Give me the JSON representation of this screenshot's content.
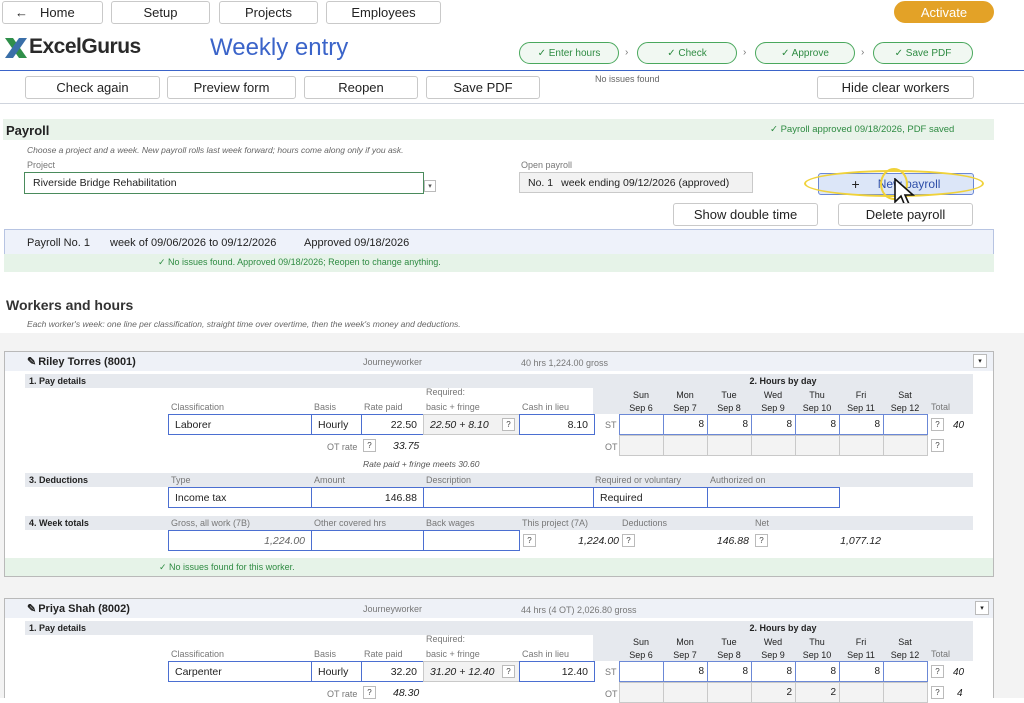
{
  "nav": {
    "home": "Home",
    "setup": "Setup",
    "projects": "Projects",
    "employees": "Employees",
    "activate": "Activate",
    "back_glyph": "←"
  },
  "brand": {
    "logo_text": "ExcelGurus",
    "page_title": "Weekly entry"
  },
  "steps": [
    "✓ Enter hours",
    "✓ Check",
    "✓ Approve",
    "✓ Save PDF"
  ],
  "toolbar": {
    "check_again": "Check again",
    "preview_form": "Preview form",
    "reopen": "Reopen",
    "save_pdf": "Save PDF",
    "status": "No issues found",
    "hide_clear": "Hide clear workers"
  },
  "payroll": {
    "title": "Payroll",
    "approved_msg": "✓ Payroll approved 09/18/2026, PDF saved",
    "hint": "Choose a project and a week. New payroll rolls last week forward; hours come along only if you ask.",
    "project_label": "Project",
    "project_value": "Riverside Bridge Rehabilitation",
    "open_label": "Open payroll",
    "open_no": "No. 1",
    "open_value": "week ending 09/12/2026  (approved)",
    "new_btn_plus": "+",
    "new_btn": "New payroll",
    "show_dt": "Show double time",
    "delete": "Delete payroll"
  },
  "summary": {
    "no": "Payroll No. 1",
    "week": "week of 09/06/2026 to 09/12/2026",
    "approved": "Approved 09/18/2026",
    "ok": "✓  No issues found. Approved 09/18/2026; Reopen to change anything."
  },
  "workers_section": {
    "title": "Workers and hours",
    "hint": "Each worker's week: one line per classification, straight time over overtime, then the week's money and deductions."
  },
  "labels": {
    "pay_details": "1. Pay details",
    "hours_by_day": "2. Hours by day",
    "deductions": "3. Deductions",
    "week_totals": "4. Week totals",
    "classification": "Classification",
    "basis": "Basis",
    "rate_paid": "Rate paid",
    "required": "Required:",
    "basic_fringe": "basic + fringe",
    "cash_in_lieu": "Cash in lieu",
    "total": "Total",
    "ot_rate": "OT rate",
    "st": "ST",
    "ot": "OT",
    "q": "?",
    "type": "Type",
    "amount": "Amount",
    "description": "Description",
    "req_vol": "Required or voluntary",
    "auth_on": "Authorized on",
    "gross_all": "Gross, all work (7B)",
    "other_hrs": "Other covered hrs",
    "back_wages": "Back wages",
    "this_project": "This project (7A)",
    "deductions_col": "Deductions",
    "net": "Net",
    "dd": "▾",
    "pencil": "✎"
  },
  "days": [
    {
      "d": "Sun",
      "dt": "Sep 6"
    },
    {
      "d": "Mon",
      "dt": "Sep 7"
    },
    {
      "d": "Tue",
      "dt": "Sep 8"
    },
    {
      "d": "Wed",
      "dt": "Sep 9"
    },
    {
      "d": "Thu",
      "dt": "Sep 10"
    },
    {
      "d": "Fri",
      "dt": "Sep 11"
    },
    {
      "d": "Sat",
      "dt": "Sep 12"
    }
  ],
  "worker1": {
    "name": "Riley Torres (8001)",
    "title": "Journeyworker",
    "summary": "40 hrs   1,224.00 gross",
    "classification": "Laborer",
    "basis": "Hourly",
    "rate": "22.50",
    "required": "22.50 + 8.10",
    "cash": "8.10",
    "ot_rate": "33.75",
    "rate_note": "Rate paid + fringe meets 30.60",
    "st": [
      "",
      "8",
      "8",
      "8",
      "8",
      "8",
      ""
    ],
    "st_total": "40",
    "ot": [
      "",
      "",
      "",
      "",
      "",
      "",
      ""
    ],
    "ot_total": "",
    "ded_type": "Income tax",
    "ded_amount": "146.88",
    "ded_desc": "",
    "ded_req": "Required",
    "ded_auth": "",
    "gross": "1,224.00",
    "other_hrs": "",
    "back_wages": "",
    "this_project": "1,224.00",
    "deductions": "146.88",
    "net": "1,077.12",
    "ok": "✓  No issues found for this worker."
  },
  "worker2": {
    "name": "Priya Shah (8002)",
    "title": "Journeyworker",
    "summary": "44 hrs (4 OT)   2,026.80 gross",
    "classification": "Carpenter",
    "basis": "Hourly",
    "rate": "32.20",
    "required": "31.20 + 12.40",
    "cash": "12.40",
    "ot_rate": "48.30",
    "st": [
      "",
      "8",
      "8",
      "8",
      "8",
      "8",
      ""
    ],
    "st_total": "40",
    "ot": [
      "",
      "",
      "",
      "2",
      "2",
      "",
      ""
    ],
    "ot_total": "4"
  }
}
